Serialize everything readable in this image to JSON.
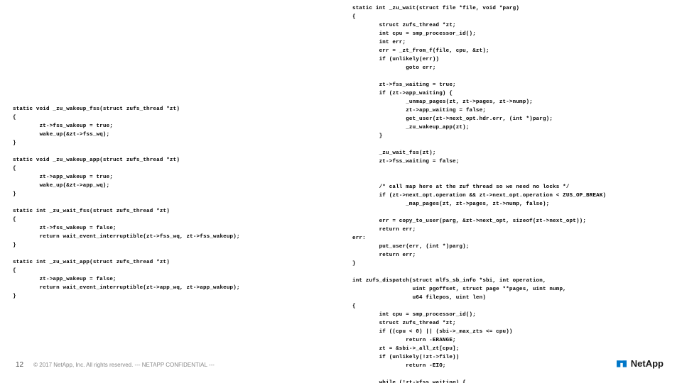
{
  "code_left": "static void _zu_wakeup_fss(struct zufs_thread *zt)\n{\n        zt->fss_wakeup = true;\n        wake_up(&zt->fss_wq);\n}\n\nstatic void _zu_wakeup_app(struct zufs_thread *zt)\n{\n        zt->app_wakeup = true;\n        wake_up(&zt->app_wq);\n}\n\nstatic int _zu_wait_fss(struct zufs_thread *zt)\n{\n        zt->fss_wakeup = false;\n        return wait_event_interruptible(zt->fss_wq, zt->fss_wakeup);\n}\n\nstatic int _zu_wait_app(struct zufs_thread *zt)\n{\n        zt->app_wakeup = false;\n        return wait_event_interruptible(zt->app_wq, zt->app_wakeup);\n}",
  "code_right": "static int _zu_wait(struct file *file, void *parg)\n{\n        struct zufs_thread *zt;\n        int cpu = smp_processor_id();\n        int err;\n        err = _zt_from_f(file, cpu, &zt);\n        if (unlikely(err))\n                goto err;\n\n        zt->fss_waiting = true;\n        if (zt->app_waiting) {\n                _unmap_pages(zt, zt->pages, zt->nump);\n                zt->app_waiting = false;\n                get_user(zt->next_opt.hdr.err, (int *)parg);\n                _zu_wakeup_app(zt);\n        }\n\n        _zu_wait_fss(zt);\n        zt->fss_waiting = false;\n\n\n        /* call map here at the zuf thread so we need no locks */\n        if (zt->next_opt.operation && zt->next_opt.operation < ZUS_OP_BREAK)\n                _map_pages(zt, zt->pages, zt->nump, false);\n\n        err = copy_to_user(parg, &zt->next_opt, sizeof(zt->next_opt));\n        return err;\nerr:\n        put_user(err, (int *)parg);\n        return err;\n}\n\nint zufs_dispatch(struct mlfs_sb_info *sbi, int operation,\n                  uint pgoffset, struct page **pages, uint nump,\n                  u64 filepos, uint len)\n{\n        int cpu = smp_processor_id();\n        struct zufs_thread *zt;\n        if ((cpu < 0) || (sbi->_max_zts <= cpu))\n                return -ERANGE;\n        zt = &sbi->_all_zt[cpu];\n        if (unlikely(!zt->file))\n                return -EIO;\n\n        while (!zt->fss_waiting) {",
  "footer": {
    "page_number": "12",
    "copyright": "© 2017 NetApp, Inc. All rights reserved.  --- NETAPP CONFIDENTIAL ---"
  },
  "logo": {
    "text": "NetApp"
  }
}
